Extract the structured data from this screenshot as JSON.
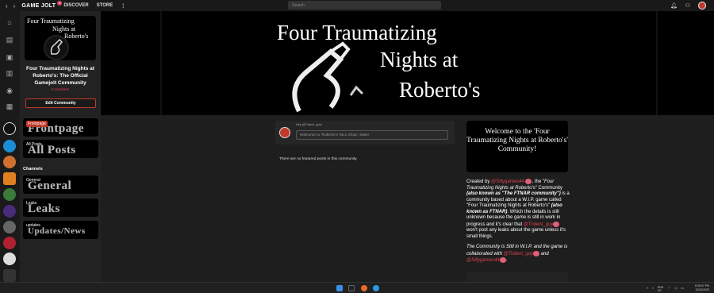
{
  "topbar": {
    "brand": "GAME JOLT",
    "brand_badge": "1",
    "links": [
      "DISCOVER",
      "STORE"
    ],
    "more": "⋮",
    "search_placeholder": "Search",
    "icons": [
      "bell-icon",
      "friends-icon",
      "user-avatar"
    ]
  },
  "community": {
    "name": "Four Traumatizing Nights at Roberto's: The Official Gamejolt Community",
    "members": "9 members",
    "edit_label": "Edit Community",
    "thumb_title": [
      "Four Traumatizing",
      "Nights at",
      "Roberto's"
    ]
  },
  "channels": {
    "heading": "Channels",
    "top": [
      {
        "label": "Frontpage",
        "art": "Frontpage"
      },
      {
        "label": "All Posts",
        "art": "All Posts"
      }
    ],
    "list": [
      {
        "label": "General",
        "art": "General"
      },
      {
        "label": "Leaks",
        "art": "Leaks"
      },
      {
        "label": "updates",
        "art": "Updates/News"
      }
    ]
  },
  "banner": {
    "line1": "Four Traumatizing",
    "line2": "Nights at",
    "line3": "Roberto's"
  },
  "post": {
    "user": "Hey @Trident_guy!",
    "placeholder": "Welcome to 'Roberto's Taco Shop', Mate!"
  },
  "feed": {
    "empty": "There are no featured posts in this community."
  },
  "welcome_card": "Welcome to the 'Four Traumatizing Nights at Roberto's' Community!",
  "description": {
    "p1_a": "Created by ",
    "p1_creator": "@Sillygames44",
    "p1_b": ", the \"",
    "p1_title": "Four Traumatizing Nights at Roberto's",
    "p1_c": "\" Community ",
    "p1_aka": "(also known as \"The FTNAR community\")",
    "p1_d": " is a community based about a W.I.P. game called \"Four Traumatizing Nights at Roberto's\" ",
    "p1_aka2": "(also known as FTNAR)",
    "p1_e": ". Which the details is still unknown because the game is still in work in progress and it's clear that ",
    "p1_user": "@Trident_guy",
    "p1_f": " won't post any leaks about the game unless it's small things.",
    "p2_a": "The Community is Still in W.I.P. and the game is collaborated with ",
    "p2_user1": "@Trident_guy",
    "p2_and": " and ",
    "p2_user2": "@Sillygames44",
    "p2_end": "."
  },
  "taskbar": {
    "tray_lang": "ENG",
    "tray_region": "US",
    "time": "8:39:07 PM",
    "date": "10/24/2025"
  }
}
